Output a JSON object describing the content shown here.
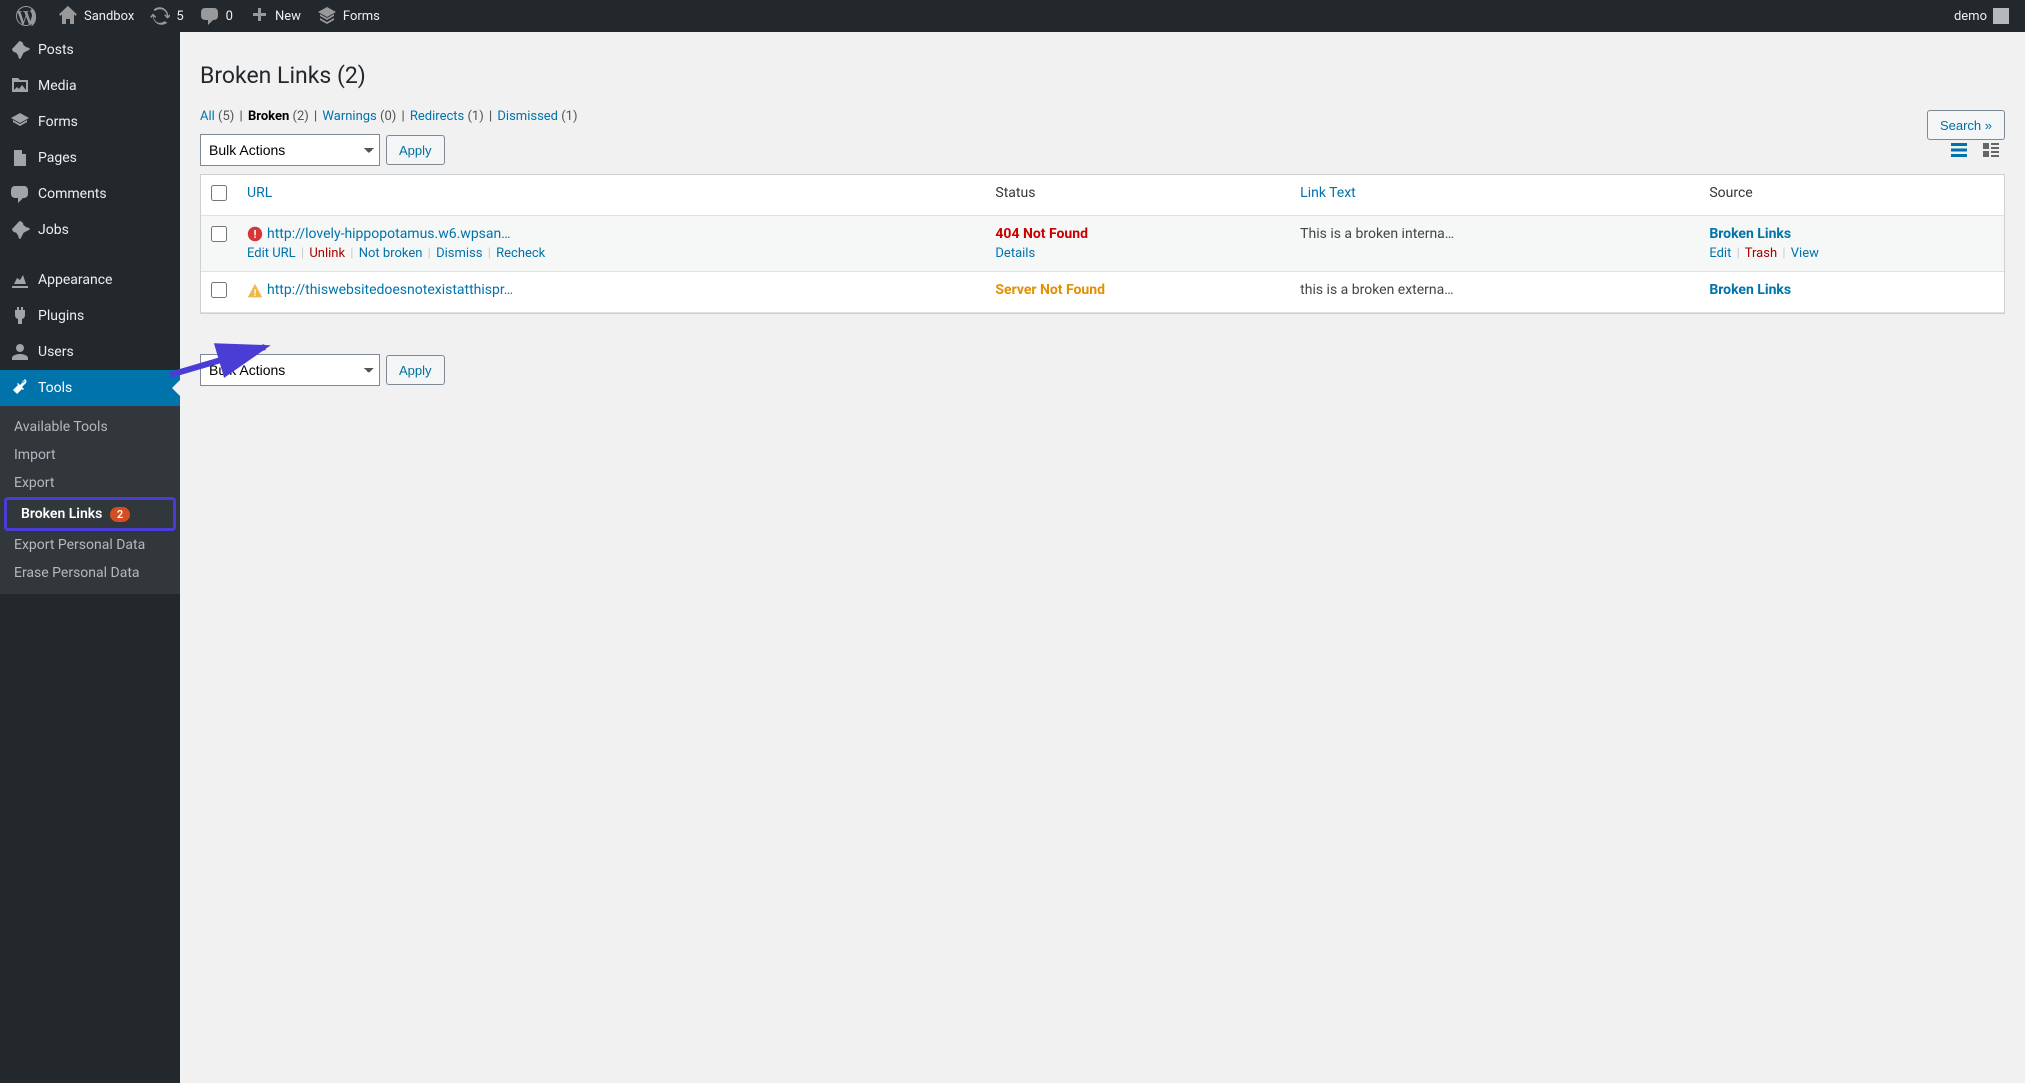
{
  "adminbar": {
    "site_name": "Sandbox",
    "updates_count": "5",
    "comments_count": "0",
    "new_label": "New",
    "forms_label": "Forms",
    "user_label": "demo"
  },
  "sidebar": {
    "items": [
      {
        "label": "Posts",
        "icon": "pin"
      },
      {
        "label": "Media",
        "icon": "media"
      },
      {
        "label": "Forms",
        "icon": "forms"
      },
      {
        "label": "Pages",
        "icon": "pages"
      },
      {
        "label": "Comments",
        "icon": "comments"
      },
      {
        "label": "Jobs",
        "icon": "pin"
      },
      {
        "label": "Appearance",
        "icon": "appearance"
      },
      {
        "label": "Plugins",
        "icon": "plugins"
      },
      {
        "label": "Users",
        "icon": "users"
      },
      {
        "label": "Tools",
        "icon": "tools",
        "current": true
      }
    ],
    "submenu": [
      {
        "label": "Available Tools"
      },
      {
        "label": "Import"
      },
      {
        "label": "Export"
      },
      {
        "label": "Broken Links",
        "current": true,
        "badge": "2",
        "highlight": true
      },
      {
        "label": "Export Personal Data"
      },
      {
        "label": "Erase Personal Data"
      }
    ]
  },
  "page": {
    "title": "Broken Links (2)",
    "filters": [
      {
        "label": "All",
        "count": "(5)"
      },
      {
        "label": "Broken",
        "count": "(2)",
        "current": true
      },
      {
        "label": "Warnings",
        "count": "(0)"
      },
      {
        "label": "Redirects",
        "count": "(1)"
      },
      {
        "label": "Dismissed",
        "count": "(1)"
      }
    ],
    "bulk_label": "Bulk Actions",
    "apply_label": "Apply",
    "search_label": "Search »",
    "columns": {
      "url": "URL",
      "status": "Status",
      "link_text": "Link Text",
      "source": "Source"
    },
    "rows": [
      {
        "icon": "error",
        "url": "http://lovely-hippopotamus.w6.wpsan…",
        "status": "404 Not Found",
        "status_class": "status-404",
        "link_text": "This is a broken interna…",
        "source": "Broken Links",
        "show_actions": true,
        "actions": {
          "edit_url": "Edit URL",
          "unlink": "Unlink",
          "not_broken": "Not broken",
          "dismiss": "Dismiss",
          "recheck": "Recheck",
          "details": "Details",
          "edit": "Edit",
          "trash": "Trash",
          "view": "View"
        }
      },
      {
        "icon": "warning",
        "url": "http://thiswebsitedoesnotexistatthispr…",
        "status": "Server Not Found",
        "status_class": "status-server",
        "link_text": "this is a broken externa…",
        "source": "Broken Links",
        "show_actions": false
      }
    ]
  }
}
